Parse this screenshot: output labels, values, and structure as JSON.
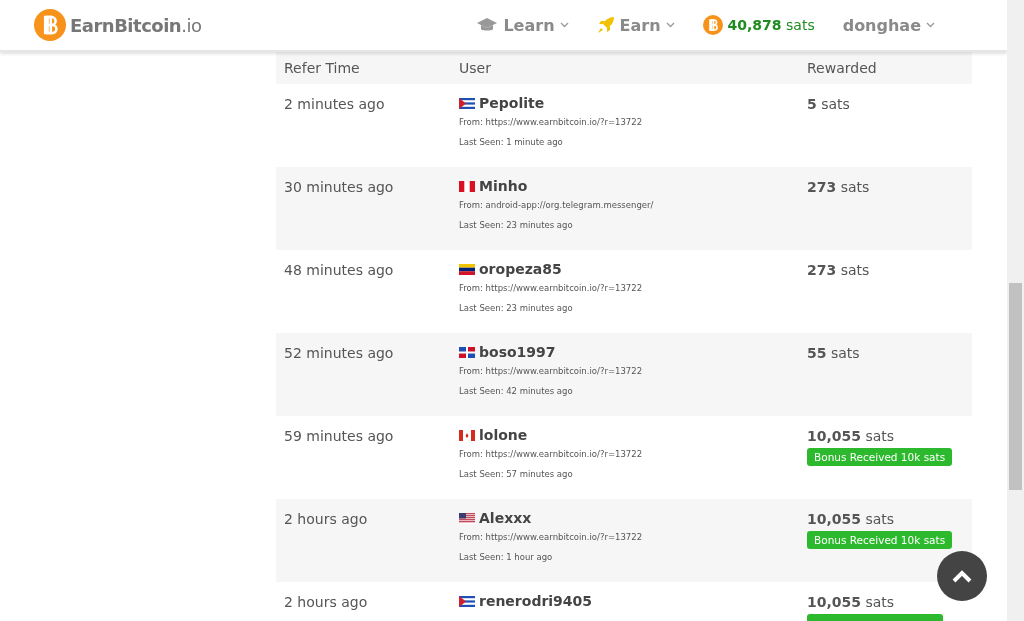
{
  "header": {
    "logo": {
      "name": "EarnBitcoin",
      "suffix": ".io"
    },
    "nav": [
      {
        "kind": "learn",
        "label": "Learn"
      },
      {
        "kind": "earn",
        "label": "Earn"
      }
    ],
    "balance": {
      "amount": "40,878",
      "unit": "sats"
    },
    "user": "donghae"
  },
  "table": {
    "columns": [
      "Refer Time",
      "User",
      "Rewarded"
    ],
    "rows": [
      {
        "time": "2 minutes ago",
        "flag": {
          "kind": "cu"
        },
        "user": "Pepolite",
        "from": "From: https://www.earnbitcoin.io/?r=13722",
        "last_seen": "Last Seen: 1 minute ago",
        "amount": "5",
        "unit": "sats"
      },
      {
        "time": "30 minutes ago",
        "flag": {
          "kind": "pe"
        },
        "user": "Minho",
        "from": "From: android-app://org.telegram.messenger/",
        "last_seen": "Last Seen: 23 minutes ago",
        "amount": "273",
        "unit": "sats"
      },
      {
        "time": "48 minutes ago",
        "flag": {
          "kind": "ve"
        },
        "user": "oropeza85",
        "from": "From: https://www.earnbitcoin.io/?r=13722",
        "last_seen": "Last Seen: 23 minutes ago",
        "amount": "273",
        "unit": "sats"
      },
      {
        "time": "52 minutes ago",
        "flag": {
          "kind": "do"
        },
        "user": "boso1997",
        "from": "From: https://www.earnbitcoin.io/?r=13722",
        "last_seen": "Last Seen: 42 minutes ago",
        "amount": "55",
        "unit": "sats"
      },
      {
        "time": "59 minutes ago",
        "flag": {
          "kind": "ca"
        },
        "user": "lolone",
        "from": "From: https://www.earnbitcoin.io/?r=13722",
        "last_seen": "Last Seen: 57 minutes ago",
        "amount": "10,055",
        "unit": "sats",
        "badge": "Bonus Received 10k sats"
      },
      {
        "time": "2 hours ago",
        "flag": {
          "kind": "us"
        },
        "user": "Alexxx",
        "from": "From: https://www.earnbitcoin.io/?r=13722",
        "last_seen": "Last Seen: 1 hour ago",
        "amount": "10,055",
        "unit": "sats",
        "badge": "Bonus Received 10k sats"
      },
      {
        "time": "2 hours ago",
        "flag": {
          "kind": "cu"
        },
        "user": "renerodri9405",
        "amount": "10,055",
        "unit": "sats",
        "badge_strip": true
      }
    ]
  }
}
